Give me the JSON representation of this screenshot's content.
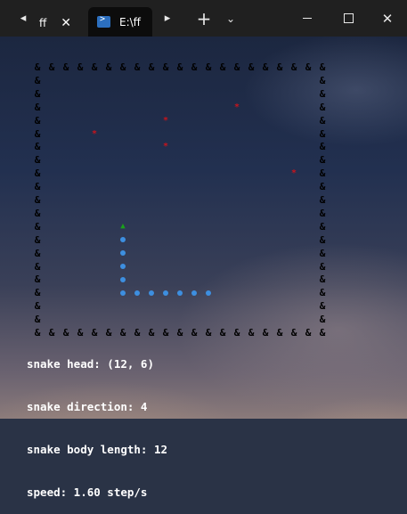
{
  "window": {
    "tabs": [
      {
        "label": "ff",
        "active": false
      },
      {
        "label": "E:\\ff",
        "active": true
      }
    ],
    "controls": [
      "minimize",
      "maximize",
      "close"
    ]
  },
  "game": {
    "wall_char": "&",
    "food_char": "*",
    "head_char": "▲",
    "grid_cols": 20,
    "grid_rows": 20,
    "food": [
      [
        14,
        3
      ],
      [
        9,
        4
      ],
      [
        4,
        5
      ],
      [
        9,
        6
      ],
      [
        18,
        8
      ]
    ],
    "snake_head": [
      6,
      12
    ],
    "snake_body": [
      [
        6,
        13
      ],
      [
        6,
        14
      ],
      [
        6,
        15
      ],
      [
        6,
        16
      ],
      [
        6,
        17
      ],
      [
        7,
        17
      ],
      [
        8,
        17
      ],
      [
        9,
        17
      ],
      [
        10,
        17
      ],
      [
        11,
        17
      ],
      [
        12,
        17
      ]
    ],
    "colors": {
      "wall": "#000000",
      "food": "#c8141c",
      "head": "#1aa31a",
      "body": "#3d8fe0"
    }
  },
  "status": {
    "head": "snake head: (12, 6)",
    "direction": "snake direction: 4",
    "length": "snake body length: 12",
    "speed": "speed: 1.60 step/s"
  }
}
